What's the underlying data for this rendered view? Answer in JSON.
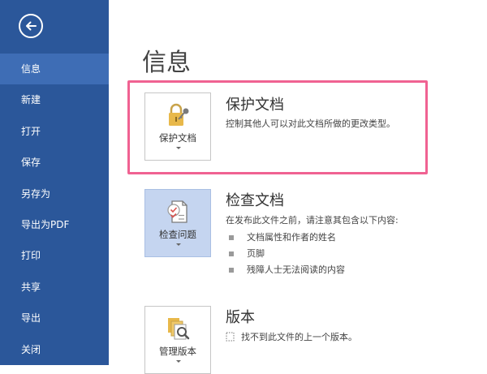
{
  "sidebar": {
    "items": [
      {
        "label": "信息",
        "active": true
      },
      {
        "label": "新建"
      },
      {
        "label": "打开"
      },
      {
        "label": "保存"
      },
      {
        "label": "另存为"
      },
      {
        "label": "导出为PDF"
      },
      {
        "label": "打印"
      },
      {
        "label": "共享"
      },
      {
        "label": "导出"
      },
      {
        "label": "关闭"
      }
    ]
  },
  "main": {
    "title": "信息",
    "protect": {
      "tile_label": "保护文档",
      "title": "保护文档",
      "description": "控制其他人可以对此文档所做的更改类型。"
    },
    "inspect": {
      "tile_label": "检查问题",
      "title": "检查文档",
      "description": "在发布此文件之前，请注意其包含以下内容:",
      "bullets": [
        "文档属性和作者的姓名",
        "页脚",
        "残障人士无法阅读的内容"
      ]
    },
    "versions": {
      "tile_label": "管理版本",
      "title": "版本",
      "description": "找不到此文件的上一个版本。"
    }
  },
  "colors": {
    "sidebar_bg": "#2b579a",
    "sidebar_active": "#3e6db5",
    "highlight_border": "#f06292",
    "selected_tile": "#c5d5f0"
  }
}
